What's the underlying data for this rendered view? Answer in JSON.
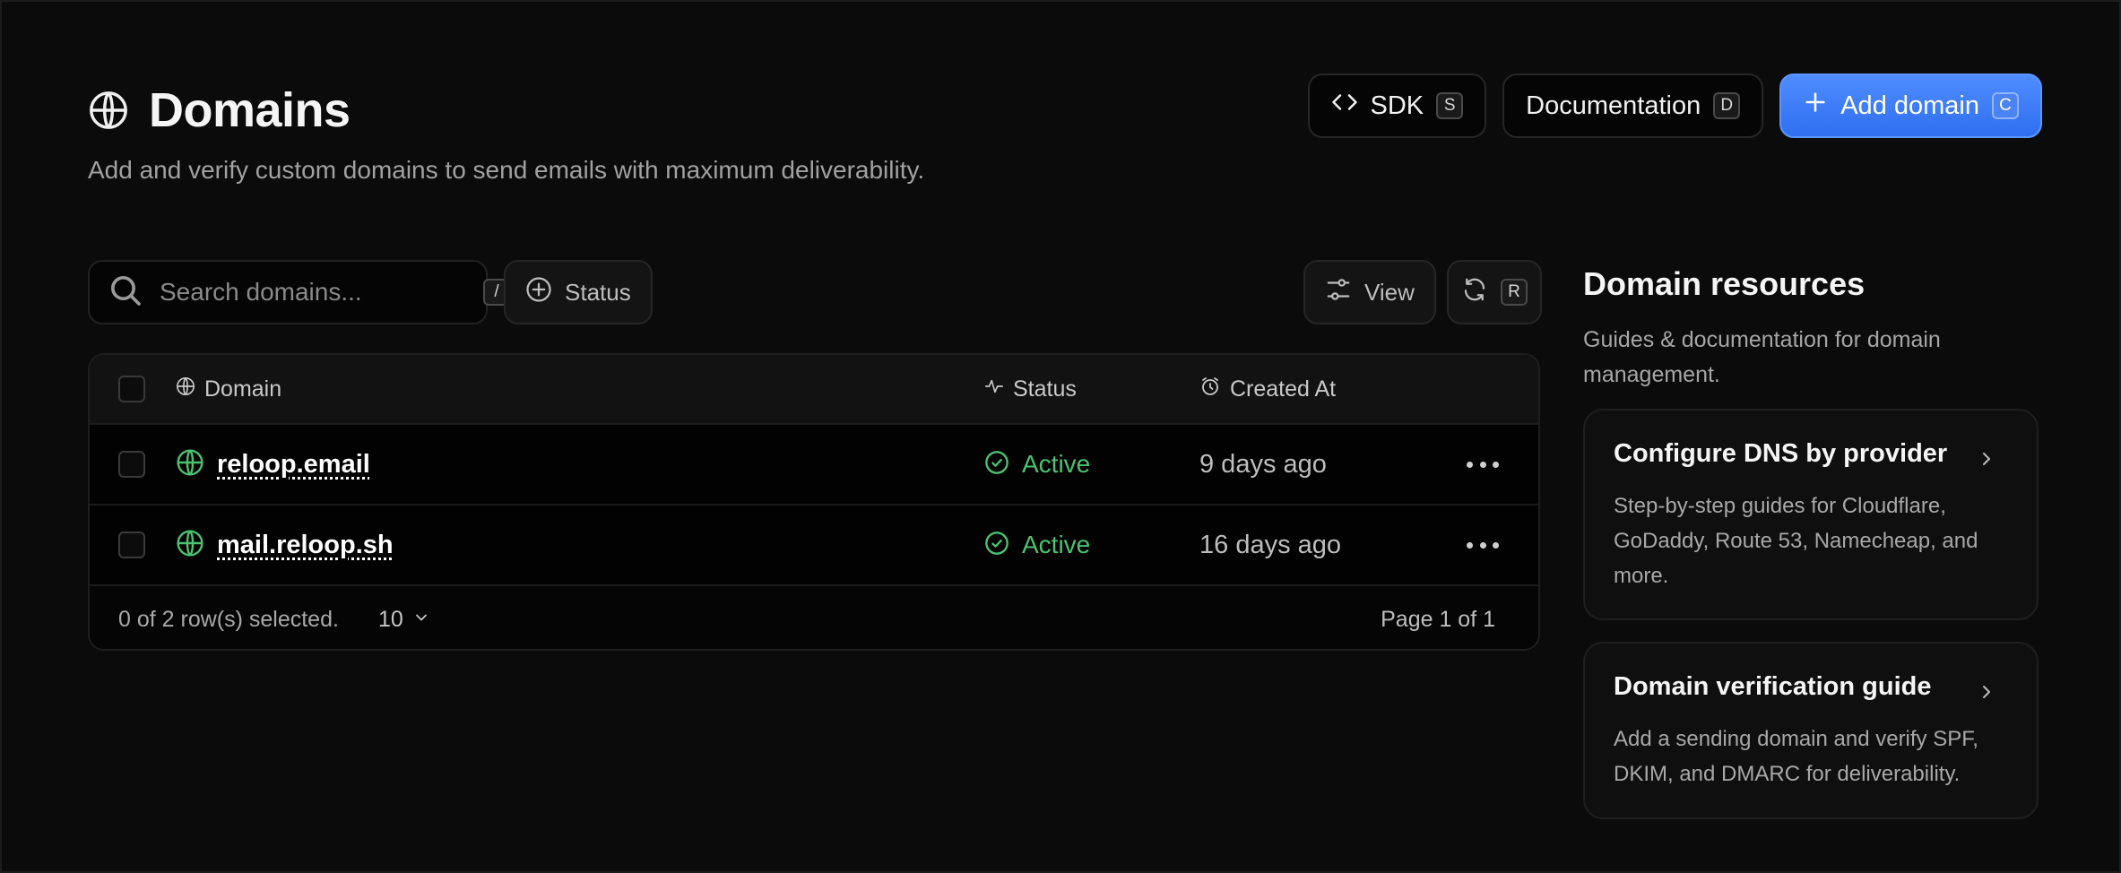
{
  "header": {
    "title": "Domains",
    "subtitle": "Add and verify custom domains to send emails with maximum deliverability.",
    "actions": [
      {
        "label": "SDK",
        "shortcut": "S",
        "icon": "code-icon"
      },
      {
        "label": "Documentation",
        "shortcut": "D"
      },
      {
        "label": "Add domain",
        "shortcut": "C",
        "icon": "plus-icon"
      }
    ]
  },
  "toolbar": {
    "search_placeholder": "Search domains...",
    "search_shortcut": "/",
    "status_filter_label": "Status",
    "view_label": "View",
    "refresh_shortcut": "R"
  },
  "table": {
    "columns": {
      "domain": "Domain",
      "status": "Status",
      "created_at": "Created At"
    },
    "rows": [
      {
        "domain": "reloop.email",
        "status": "Active",
        "created_at": "9 days ago"
      },
      {
        "domain": "mail.reloop.sh",
        "status": "Active",
        "created_at": "16 days ago"
      }
    ],
    "footer": {
      "selection": "0 of 2 row(s) selected.",
      "page_size": "10",
      "page_label": "Page 1 of 1"
    }
  },
  "resources": {
    "title": "Domain resources",
    "subtitle": "Guides & documentation for domain management.",
    "cards": [
      {
        "title": "Configure DNS by provider",
        "description": "Step-by-step guides for Cloudflare, GoDaddy, Route 53, Namecheap, and more."
      },
      {
        "title": "Domain verification guide",
        "description": "Add a sending domain and verify SPF, DKIM, and DMARC for deliverability."
      }
    ]
  },
  "colors": {
    "background": "#0b0b0b",
    "accent": "#3b7bf7",
    "success": "#4cc271"
  }
}
